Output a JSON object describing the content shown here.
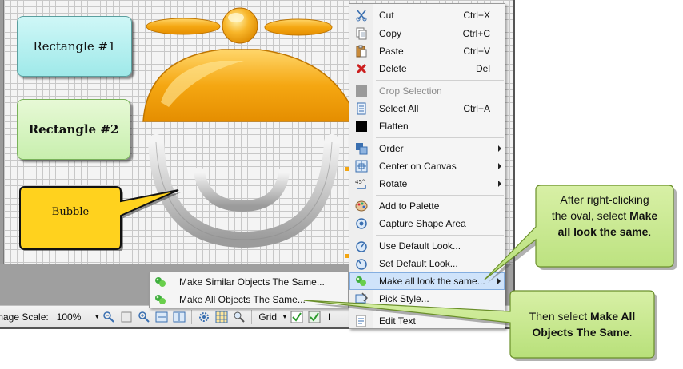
{
  "canvas": {
    "rect1_label": "Rectangle #1",
    "rect2_label": "Rectangle #2",
    "bubble_label": "Bubble"
  },
  "toolbar": {
    "image_scale_label": "mage Scale:",
    "image_scale_value": "100%",
    "grid_label": "Grid",
    "trailing_text": "I"
  },
  "submenu": {
    "items": [
      {
        "label": "Make Similar Objects The Same...",
        "icon": "paint-drops-icon"
      },
      {
        "label": "Make All Objects The Same...",
        "icon": "paint-drops-icon"
      }
    ]
  },
  "context_menu": {
    "items": [
      {
        "label": "Cut",
        "shortcut": "Ctrl+X",
        "icon": "scissors-icon"
      },
      {
        "label": "Copy",
        "shortcut": "Ctrl+C",
        "icon": "copy-icon"
      },
      {
        "label": "Paste",
        "shortcut": "Ctrl+V",
        "icon": "paste-icon"
      },
      {
        "label": "Delete",
        "shortcut": "Del",
        "icon": "delete-x-icon"
      },
      {
        "label": "Crop Selection",
        "shortcut": "",
        "icon": "crop-icon",
        "disabled": true
      },
      {
        "label": "Select All",
        "shortcut": "Ctrl+A",
        "icon": "select-all-icon"
      },
      {
        "label": "Flatten",
        "shortcut": "",
        "icon": "flatten-icon"
      },
      {
        "label": "Order",
        "shortcut": "",
        "icon": "order-icon",
        "submenu": true
      },
      {
        "label": "Center on Canvas",
        "shortcut": "",
        "icon": "center-icon",
        "submenu": true
      },
      {
        "label": "Rotate",
        "shortcut": "",
        "icon": "rotate-45-icon",
        "submenu": true
      },
      {
        "label": "Add to Palette",
        "shortcut": "",
        "icon": "palette-icon"
      },
      {
        "label": "Capture Shape Area",
        "shortcut": "",
        "icon": "capture-icon"
      },
      {
        "label": "Use Default Look...",
        "shortcut": "",
        "icon": "default-look-icon"
      },
      {
        "label": "Set Default Look...",
        "shortcut": "",
        "icon": "set-default-look-icon"
      },
      {
        "label": "Make all look the same...",
        "shortcut": "",
        "icon": "paint-drops-icon",
        "submenu": true,
        "highlight": true
      },
      {
        "label": "Pick Style...",
        "shortcut": "",
        "icon": "pick-style-icon"
      },
      {
        "label": "Edit Text",
        "shortcut": "",
        "icon": "edit-text-icon"
      }
    ]
  },
  "callouts": {
    "first": {
      "line1": "After right-clicking",
      "line2a": "the oval, select ",
      "line2b": "Make",
      "line3": "all look the same",
      "line3end": "."
    },
    "second": {
      "line1a": "Then select ",
      "line1b": "Make All",
      "line2": "Objects The Same",
      "line2end": "."
    }
  },
  "colors": {
    "callout_fill": "#c5e785",
    "callout_border": "#6a8f2a",
    "orange_shape": "#f2a61a",
    "bubble_fill": "#ffd21e",
    "menu_highlight": "#cfe3fa"
  }
}
